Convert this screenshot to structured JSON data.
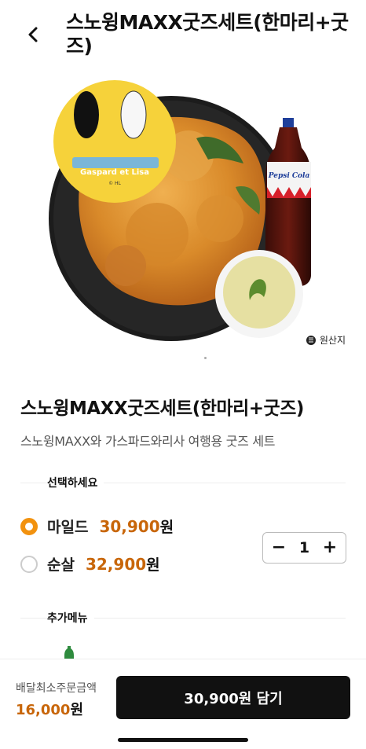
{
  "header": {
    "title": "스노윙MAXX굿즈세트(한마리+굿즈)"
  },
  "hero": {
    "badge_text": "Gaspard et Lisa",
    "badge_sub": "© HL",
    "bottle_text": "Pepsi Cola",
    "origin_label": "원산지"
  },
  "product": {
    "name": "스노윙MAXX굿즈세트(한마리+굿즈)",
    "description": "스노윙MAXX와 가스파드와리사 여행용 굿즈 세트"
  },
  "options": {
    "heading": "선택하세요",
    "items": [
      {
        "name": "마일드",
        "price": "30,900",
        "unit": "원",
        "selected": true
      },
      {
        "name": "순살",
        "price": "32,900",
        "unit": "원",
        "selected": false
      }
    ]
  },
  "quantity": {
    "minus": "−",
    "value": "1",
    "plus": "+"
  },
  "addons": {
    "heading": "추가메뉴"
  },
  "footer": {
    "min_order_label": "배달최소주문금액",
    "min_order_amount": "16,000",
    "min_order_unit": "원",
    "cart_button": "30,900원 담기"
  },
  "colors": {
    "accent": "#F2920F",
    "price": "#C8660A",
    "button": "#111111"
  }
}
